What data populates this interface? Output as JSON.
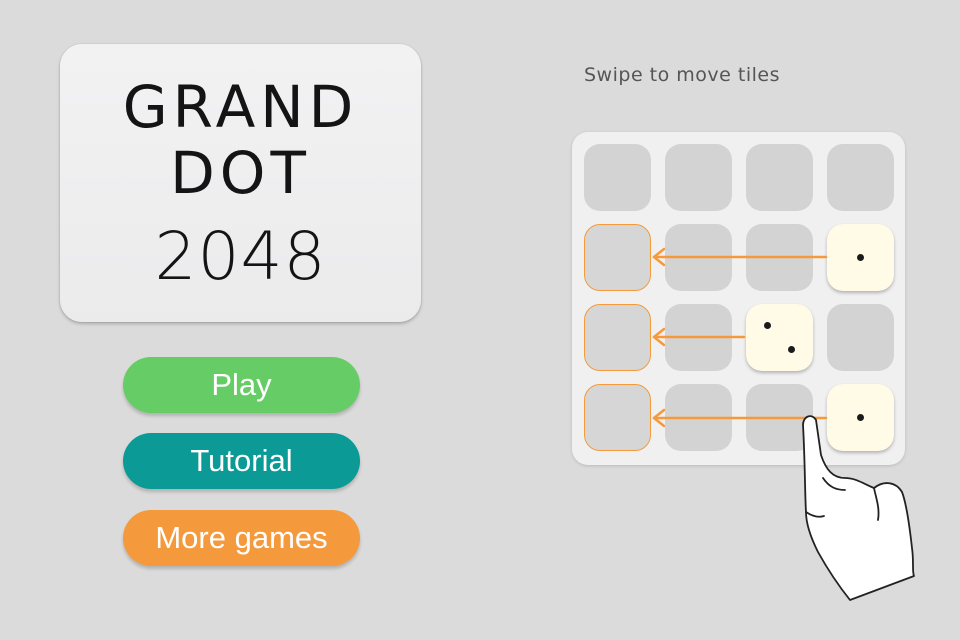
{
  "title": {
    "line1": "GRAND",
    "line2": "DOT",
    "line3": "2048"
  },
  "menu": {
    "play_label": "Play",
    "tutorial_label": "Tutorial",
    "more_games_label": "More games"
  },
  "tutorial_hint": {
    "text": "Swipe to move tiles"
  },
  "board": {
    "rows": 4,
    "cols": 4,
    "dice": [
      {
        "row": 1,
        "col": 3,
        "value": 1
      },
      {
        "row": 2,
        "col": 2,
        "value": 2
      },
      {
        "row": 3,
        "col": 3,
        "value": 1
      }
    ],
    "targets": [
      {
        "row": 1,
        "col": 0
      },
      {
        "row": 2,
        "col": 0
      },
      {
        "row": 3,
        "col": 0
      }
    ],
    "swipe_direction": "left"
  },
  "colors": {
    "background": "#dbdbdb",
    "play": "#66cd66",
    "tutorial": "#0c9a96",
    "more_games": "#f59a3c",
    "arrow": "#f59a3c",
    "die_face": "#fffbe6",
    "empty_cell": "#d3d3d3"
  },
  "icons": {
    "pointer": "hand-pointer-icon",
    "arrow": "arrow-left-icon"
  }
}
